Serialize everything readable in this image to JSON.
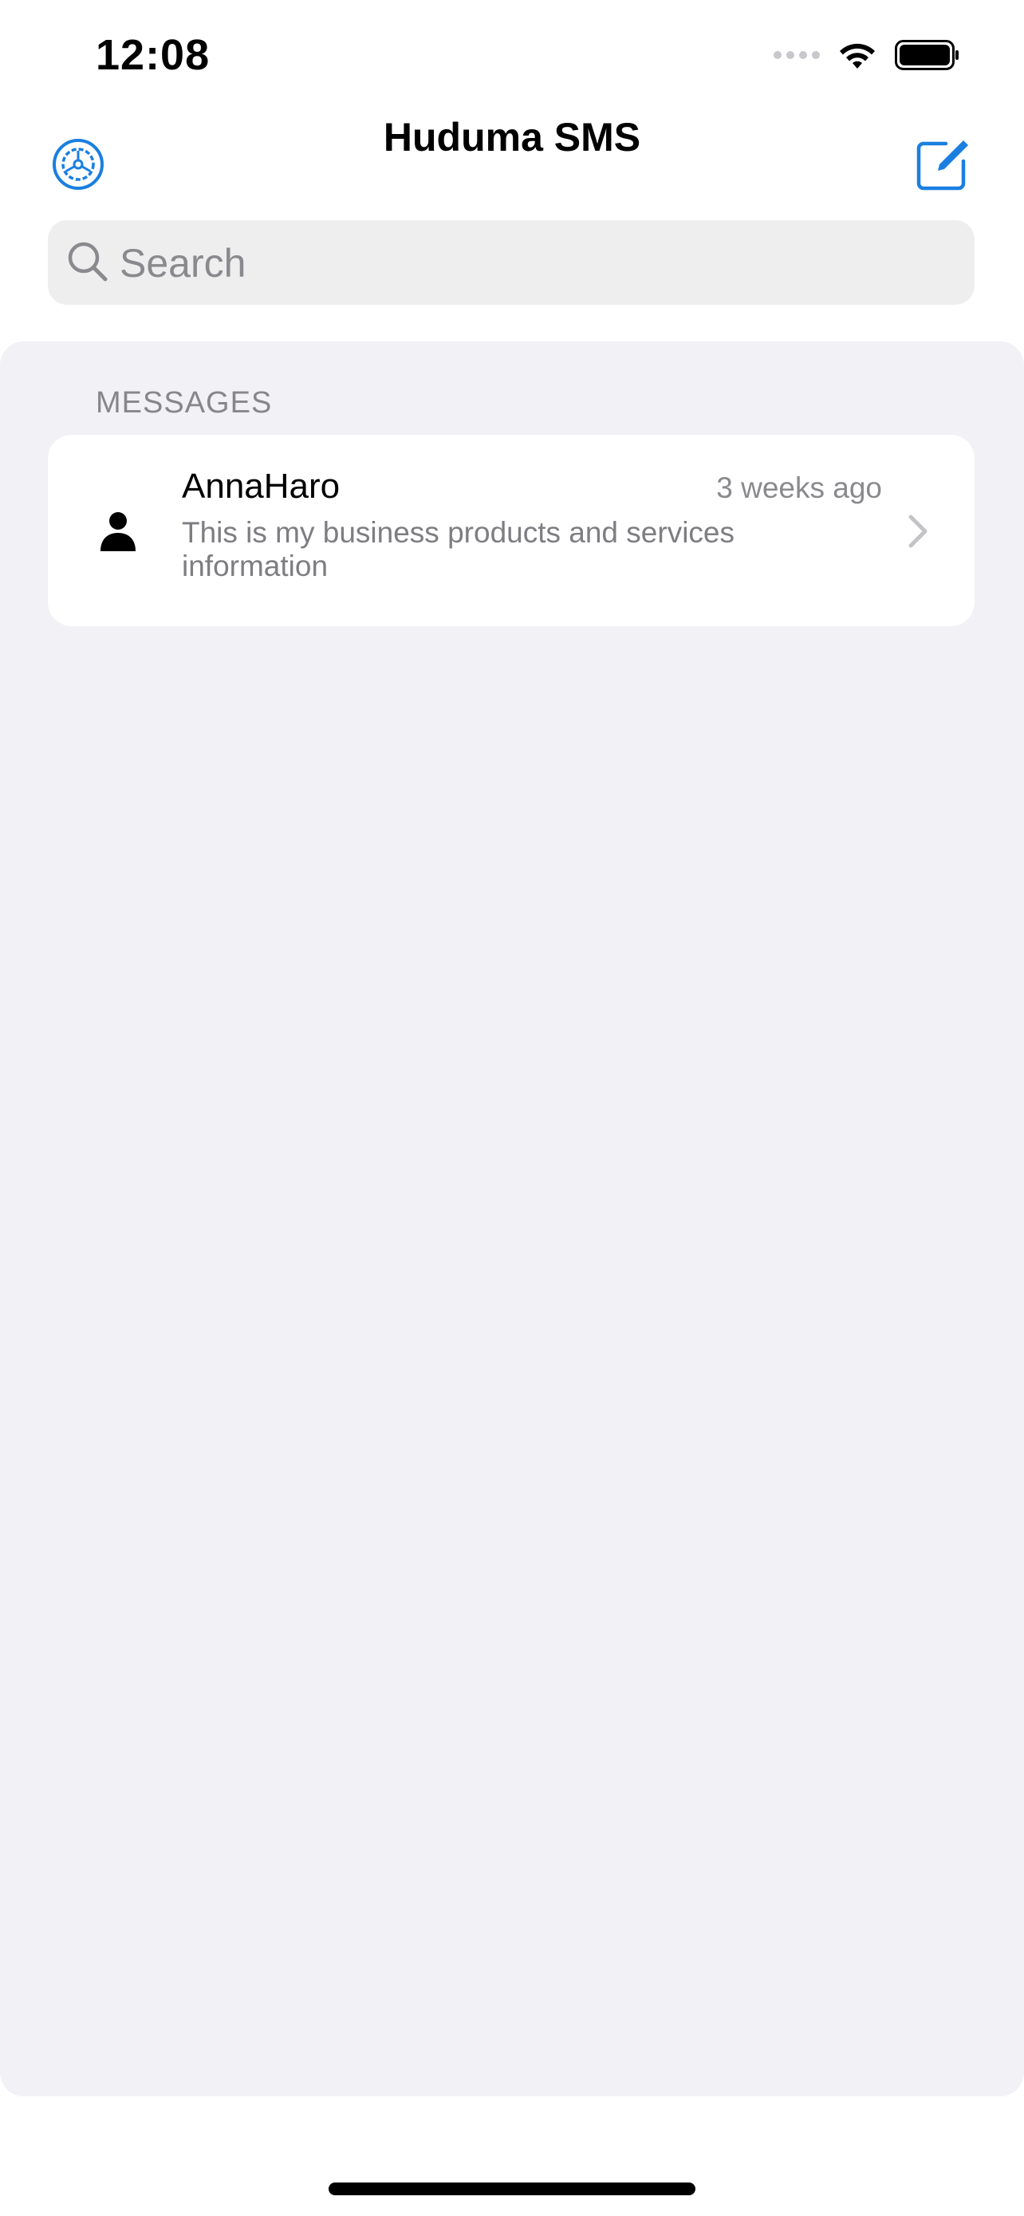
{
  "status_bar": {
    "time": "12:08",
    "icons": [
      "signal-dots-icon",
      "wifi-icon",
      "battery-icon"
    ]
  },
  "nav": {
    "title": "Huduma SMS",
    "left_icon": "settings-gear-icon",
    "right_icon": "compose-icon",
    "accent_color": "#1a7fe0"
  },
  "search": {
    "placeholder": "Search",
    "value": ""
  },
  "messages_section": {
    "header": "MESSAGES",
    "items": [
      {
        "sender": "AnnaHaro",
        "timestamp": "3 weeks ago",
        "preview": "This is my business products and services information",
        "avatar_icon": "person-icon"
      }
    ]
  },
  "colors": {
    "background": "#ffffff",
    "panel": "#f1f1f6",
    "secondary_text": "#8a8a8e"
  }
}
